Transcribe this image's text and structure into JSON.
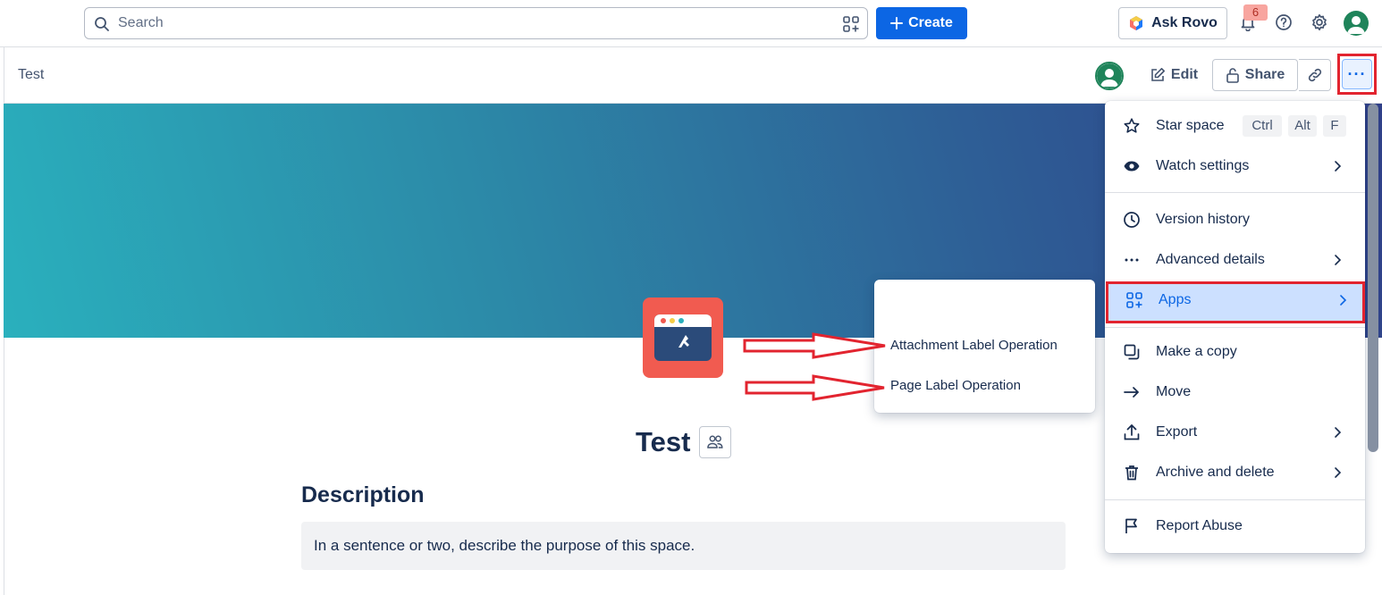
{
  "topnav": {
    "search_placeholder": "Search",
    "create_label": "Create",
    "rovo_label": "Ask Rovo",
    "notification_count": "6"
  },
  "subheader": {
    "breadcrumb": "Test",
    "edit_label": "Edit",
    "share_label": "Share",
    "more_label": "···"
  },
  "page": {
    "title": "Test",
    "description_heading": "Description",
    "description_placeholder": "In a sentence or two, describe the purpose of this space."
  },
  "apps_submenu": {
    "items": [
      "Attachment Label Operation",
      "Page Label Operation"
    ]
  },
  "more_menu": {
    "star_space": "Star space",
    "shortcut_keys": [
      "Ctrl",
      "Alt",
      "F"
    ],
    "watch_settings": "Watch settings",
    "version_history": "Version history",
    "advanced_details": "Advanced details",
    "apps": "Apps",
    "make_copy": "Make a copy",
    "move": "Move",
    "export": "Export",
    "archive_delete": "Archive and delete",
    "report_abuse": "Report Abuse"
  },
  "colors": {
    "accent": "#0c66e4",
    "highlight": "#e2242f",
    "app_icon_bg": "#f15b50",
    "banner_start": "#2ab0bd",
    "banner_end": "#2f3f88"
  }
}
